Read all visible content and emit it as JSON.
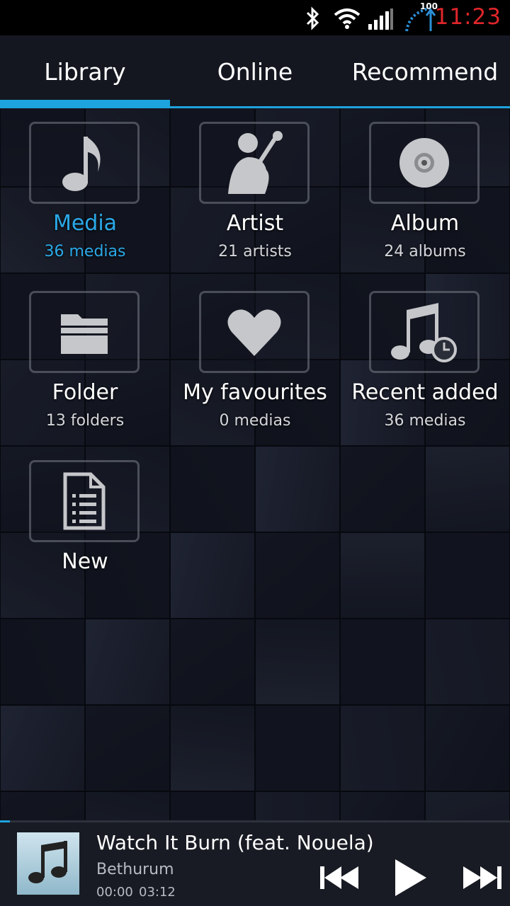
{
  "status_bar": {
    "icons": [
      "bluetooth-icon",
      "wifi-icon",
      "signal-icon",
      "battery-charging-icon"
    ],
    "battery_level": "100",
    "clock": "11:23"
  },
  "tabs": [
    {
      "label": "Library",
      "selected": true
    },
    {
      "label": "Online",
      "selected": false
    },
    {
      "label": "Recommend",
      "selected": false
    }
  ],
  "colors": {
    "accent": "#1da3dd",
    "clock": "#e0262a",
    "active_text": "#2aa9e8"
  },
  "library": {
    "items": [
      {
        "title": "Media",
        "subtitle": "36 medias",
        "icon": "music-note-icon",
        "active": true
      },
      {
        "title": "Artist",
        "subtitle": "21 artists",
        "icon": "singer-icon",
        "active": false
      },
      {
        "title": "Album",
        "subtitle": "24 albums",
        "icon": "disc-icon",
        "active": false
      },
      {
        "title": "Folder",
        "subtitle": "13 folders",
        "icon": "folder-icon",
        "active": false
      },
      {
        "title": "My favourites",
        "subtitle": "0 medias",
        "icon": "heart-icon",
        "active": false
      },
      {
        "title": "Recent added",
        "subtitle": "36 medias",
        "icon": "recent-music-icon",
        "active": false
      },
      {
        "title": "New",
        "subtitle": "",
        "icon": "document-icon",
        "active": false
      }
    ]
  },
  "player": {
    "title": "Watch It Burn (feat. Nouela)",
    "artist": "Bethurum",
    "elapsed": "00:00",
    "duration": "03:12",
    "progress": 0.02,
    "controls": [
      "previous-icon",
      "play-icon",
      "next-icon"
    ]
  }
}
